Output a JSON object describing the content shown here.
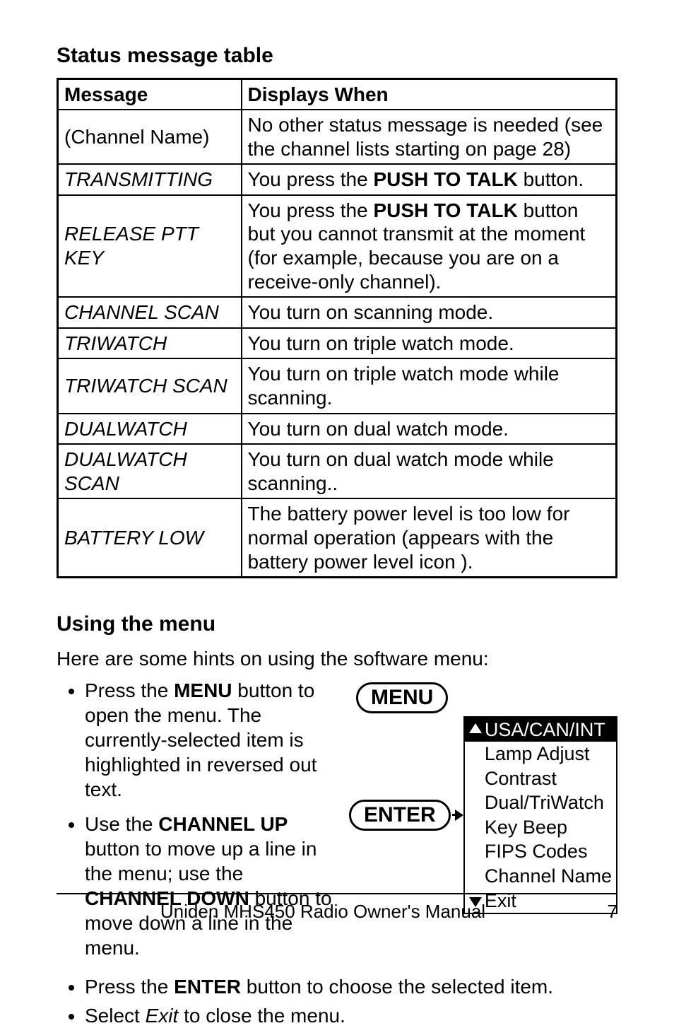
{
  "section1_title": "Status message table",
  "table": {
    "head": {
      "c1": "Message",
      "c2": "Displays When"
    },
    "rows": [
      {
        "msg": "(Channel Name)",
        "italic": false,
        "desc_pre": "No other status message is needed (see the channel lists starting on page 28)",
        "bold": "",
        "desc_post": ""
      },
      {
        "msg": "TRANSMITTING",
        "italic": true,
        "desc_pre": "You press the ",
        "bold": "PUSH TO TALK",
        "desc_post": " button."
      },
      {
        "msg": "RELEASE PTT KEY",
        "italic": true,
        "desc_pre": "You press the ",
        "bold": "PUSH TO TALK",
        "desc_post": " button but you cannot transmit at the moment (for example, because you are on a receive-only channel)."
      },
      {
        "msg": "CHANNEL SCAN",
        "italic": true,
        "desc_pre": "You turn on scanning mode.",
        "bold": "",
        "desc_post": ""
      },
      {
        "msg": "TRIWATCH",
        "italic": true,
        "desc_pre": "You turn on triple watch mode.",
        "bold": "",
        "desc_post": ""
      },
      {
        "msg": "TRIWATCH SCAN",
        "italic": true,
        "desc_pre": "You turn on triple watch mode while scanning.",
        "bold": "",
        "desc_post": ""
      },
      {
        "msg": "DUALWATCH",
        "italic": true,
        "desc_pre": "You turn on dual watch mode.",
        "bold": "",
        "desc_post": ""
      },
      {
        "msg": "DUALWATCH SCAN",
        "italic": true,
        "desc_pre": "You turn on dual watch mode while scanning..",
        "bold": "",
        "desc_post": ""
      },
      {
        "msg": "BATTERY LOW",
        "italic": true,
        "desc_pre": "The battery power level is too low for normal operation (appears with the battery power level icon ).",
        "bold": "",
        "desc_post": ""
      }
    ]
  },
  "section2_title": "Using the menu",
  "intro": "Here are some hints on using the software menu:",
  "hints_col": [
    {
      "pre": "Press the ",
      "bold1": "MENU",
      "mid": " button to open the menu. The currently-selected item is highlighted in reversed out text.",
      "bold2": "",
      "tail": ""
    },
    {
      "pre": "Use the ",
      "bold1": "CHANNEL UP",
      "mid": " button to move up a line in the menu; use the ",
      "bold2": "CHANNEL DOWN",
      "tail": " button to move down a line in the menu."
    }
  ],
  "hints_bottom": [
    {
      "pre": "Press the ",
      "bold1": "ENTER",
      "mid": " button to choose the selected item.",
      "bold2": "",
      "tail": ""
    },
    {
      "pre": "Select ",
      "italic": "Exit",
      "mid": " to close the menu."
    }
  ],
  "diagram": {
    "menu_label": "MENU",
    "enter_label": "ENTER",
    "items": [
      "USA/CAN/INT",
      "Lamp Adjust",
      "Contrast",
      "Dual/TriWatch",
      "Key Beep",
      "FIPS Codes",
      "Channel Name",
      "Exit"
    ],
    "selected_index": 0
  },
  "footer": {
    "title": "Uniden MHS450 Radio Owner's Manual",
    "page": "7"
  }
}
